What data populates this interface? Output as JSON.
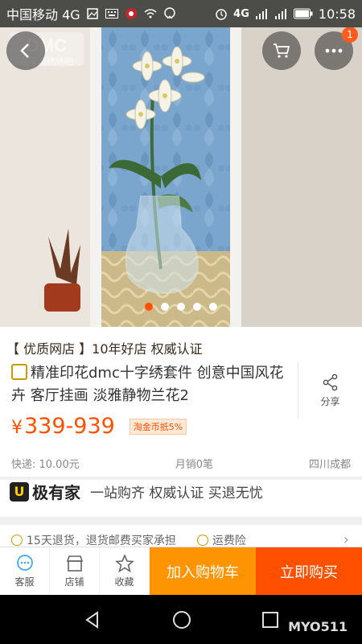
{
  "status_bar": {
    "carrier": "中国移动 4G",
    "network": "4G",
    "time": "10:58"
  },
  "hero": {
    "watermark_brand": "DMC",
    "watermark_sub": "在下雨绣绣吧",
    "cart_badge": "1",
    "page_count": 5,
    "active_page": 1
  },
  "product": {
    "shop_tag": "【 优质网店 】10年好店 权威认证",
    "title": "精准印花dmc十字绣套件 创意中国风花卉 客厅挂画 淡雅静物兰花2",
    "share_label": "分享",
    "price_symbol": "¥",
    "price": "339-939",
    "coin_tag": "淘金币抵5%",
    "shipping": "快递: 10.00元",
    "monthly_sales": "月销0笔",
    "location": "四川成都"
  },
  "jiyoujia": {
    "logo_char": "U",
    "logo_text": "极有家",
    "slogan": "一站购齐 权威认证 买退无忧"
  },
  "guarantees": {
    "item1": "15天退货，退货邮费买家承担",
    "item2": "运费险"
  },
  "actions": {
    "service": "客服",
    "store": "店铺",
    "favorite": "收藏",
    "add_to_cart": "加入购物车",
    "buy_now": "立即购买"
  },
  "nav_watermark": "MYO511",
  "colors": {
    "accent": "#ff5000",
    "cart_button": "#ff9402",
    "status_bar": "#4c4c48"
  }
}
